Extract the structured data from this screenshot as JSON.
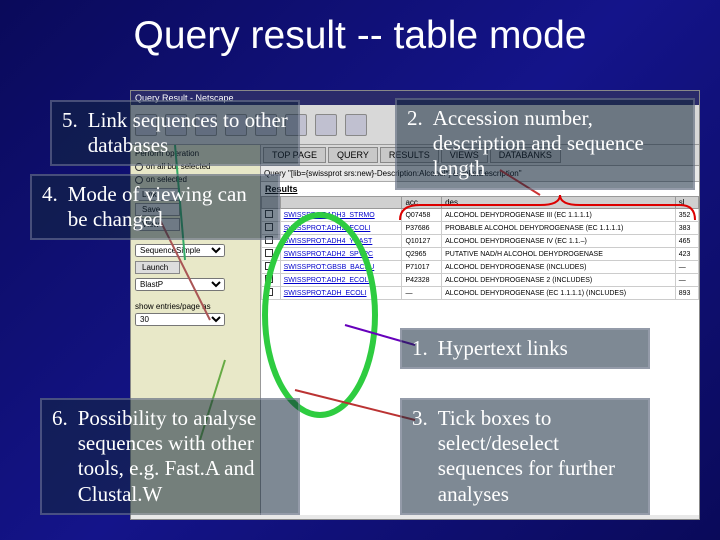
{
  "title": "Query result -- table mode",
  "browser": {
    "window_title": "Query Result - Netscape",
    "tabs": [
      "TOP PAGE",
      "QUERY",
      "RESULTS",
      "VIEWS",
      "DATABANKS"
    ],
    "query_text": "Query \"[lib={swissprot srs:new}-Description:Alcohol*] & links:Description\"",
    "result_header": "Results",
    "leftpanel": {
      "perform_op": "Perform operation",
      "on_all": "on all but selected",
      "on_selected": "on selected",
      "link_btn": "Link",
      "save_btn": "Save",
      "view_btn": "View",
      "seq_simple": "SequenceSimple",
      "launch_btn": "Launch",
      "blast_opt": "BlastP",
      "show_text": "show entries/page as",
      "per_page": "30"
    },
    "table": {
      "cols": [
        "",
        "",
        "acc",
        "des",
        "sl"
      ],
      "rows": [
        {
          "id": "SWISSPROT:ADH3_STRMO",
          "acc": "Q07458",
          "des": "ALCOHOL DEHYDROGENASE III (EC 1.1.1.1)",
          "sl": "352"
        },
        {
          "id": "SWISSPROT:ADH2_ECOLI",
          "acc": "P37686",
          "des": "PROBABLE ALCOHOL DEHYDROGENASE (EC 1.1.1.1)",
          "sl": "383"
        },
        {
          "id": "SWISSPROT:ADH4_YEAST",
          "acc": "Q10127",
          "des": "ALCOHOL DEHYDROGENASE IV (EC 1.1.–)",
          "sl": "465"
        },
        {
          "id": "SWISSPROT:ADH2_SPVPC",
          "acc": "Q2965",
          "des": "PUTATIVE NAD/H ALCOHOL DEHYDROGENASE",
          "sl": "423"
        },
        {
          "id": "SWISSPROT:GBSB_BACSU",
          "acc": "P71017",
          "des": "ALCOHOL DEHYDROGENASE (INCLUDES)",
          "sl": "—"
        },
        {
          "id": "SWISSPROT:ADH2_ECOLI",
          "acc": "P42328",
          "des": "ALCOHOL DEHYDROGENASE 2 (INCLUDES)",
          "sl": "—"
        },
        {
          "id": "SWISSPROT:ADH_ECOLI",
          "acc": "—",
          "des": "ALCOHOL DEHYDROGENASE (EC 1.1.1.1) (INCLUDES)",
          "sl": "893"
        }
      ]
    }
  },
  "callouts": {
    "c5": {
      "n": "5.",
      "text": "Link sequences to other databases"
    },
    "c4": {
      "n": "4.",
      "text": "Mode of viewing can be changed"
    },
    "c6": {
      "n": "6.",
      "text": "Possibility to analyse sequences with other tools, e.g. Fast.A and Clustal.W"
    },
    "c2": {
      "n": "2.",
      "text": "Accession number, description and sequence length"
    },
    "c1": {
      "n": "1.",
      "text": "Hypertext links"
    },
    "c3": {
      "n": "3.",
      "text": "Tick boxes to select/deselect sequences for further analyses"
    }
  }
}
